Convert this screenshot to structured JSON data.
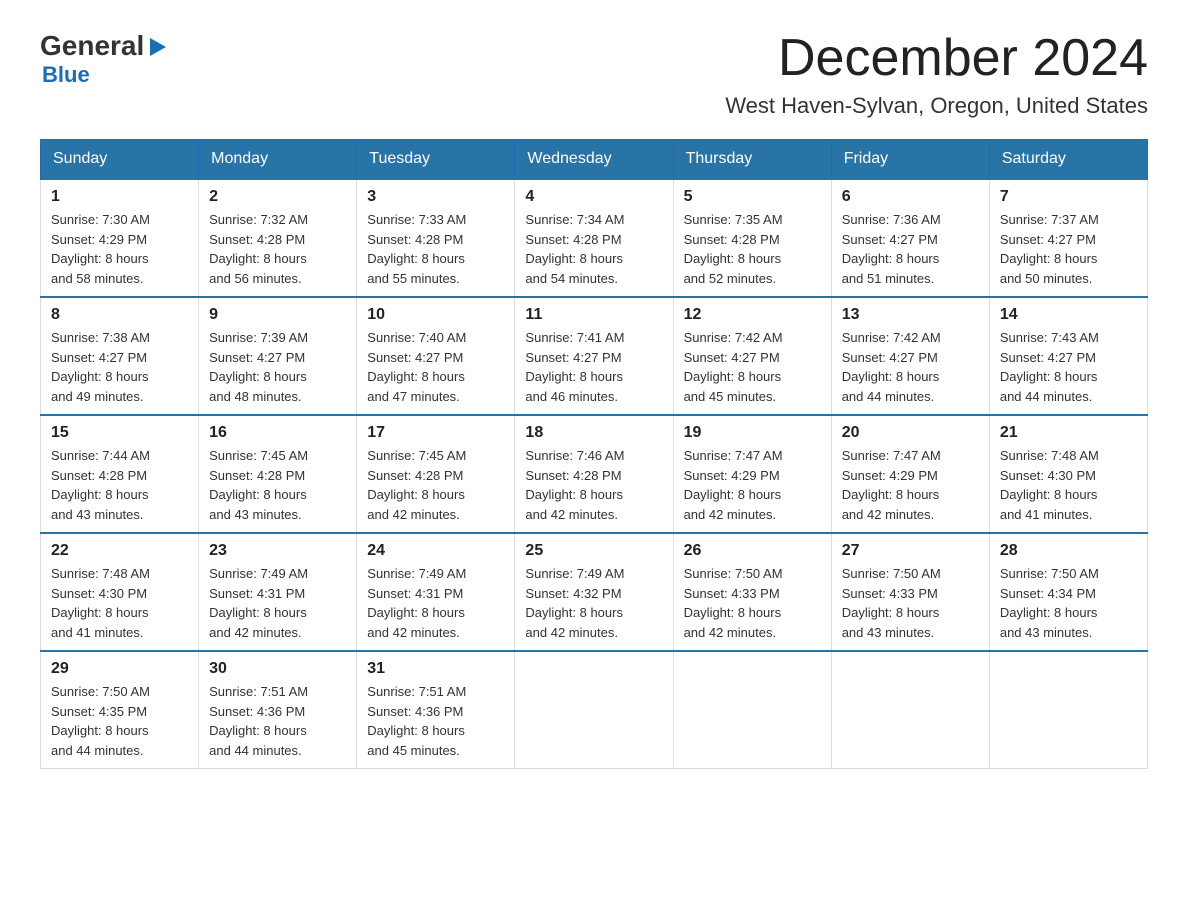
{
  "header": {
    "logo_general": "General",
    "logo_blue": "Blue",
    "logo_sub": "Blue",
    "calendar_title": "December 2024",
    "location": "West Haven-Sylvan, Oregon, United States"
  },
  "days_of_week": [
    "Sunday",
    "Monday",
    "Tuesday",
    "Wednesday",
    "Thursday",
    "Friday",
    "Saturday"
  ],
  "weeks": [
    [
      {
        "day": "1",
        "sunrise": "7:30 AM",
        "sunset": "4:29 PM",
        "daylight_hours": "8",
        "daylight_minutes": "58"
      },
      {
        "day": "2",
        "sunrise": "7:32 AM",
        "sunset": "4:28 PM",
        "daylight_hours": "8",
        "daylight_minutes": "56"
      },
      {
        "day": "3",
        "sunrise": "7:33 AM",
        "sunset": "4:28 PM",
        "daylight_hours": "8",
        "daylight_minutes": "55"
      },
      {
        "day": "4",
        "sunrise": "7:34 AM",
        "sunset": "4:28 PM",
        "daylight_hours": "8",
        "daylight_minutes": "54"
      },
      {
        "day": "5",
        "sunrise": "7:35 AM",
        "sunset": "4:28 PM",
        "daylight_hours": "8",
        "daylight_minutes": "52"
      },
      {
        "day": "6",
        "sunrise": "7:36 AM",
        "sunset": "4:27 PM",
        "daylight_hours": "8",
        "daylight_minutes": "51"
      },
      {
        "day": "7",
        "sunrise": "7:37 AM",
        "sunset": "4:27 PM",
        "daylight_hours": "8",
        "daylight_minutes": "50"
      }
    ],
    [
      {
        "day": "8",
        "sunrise": "7:38 AM",
        "sunset": "4:27 PM",
        "daylight_hours": "8",
        "daylight_minutes": "49"
      },
      {
        "day": "9",
        "sunrise": "7:39 AM",
        "sunset": "4:27 PM",
        "daylight_hours": "8",
        "daylight_minutes": "48"
      },
      {
        "day": "10",
        "sunrise": "7:40 AM",
        "sunset": "4:27 PM",
        "daylight_hours": "8",
        "daylight_minutes": "47"
      },
      {
        "day": "11",
        "sunrise": "7:41 AM",
        "sunset": "4:27 PM",
        "daylight_hours": "8",
        "daylight_minutes": "46"
      },
      {
        "day": "12",
        "sunrise": "7:42 AM",
        "sunset": "4:27 PM",
        "daylight_hours": "8",
        "daylight_minutes": "45"
      },
      {
        "day": "13",
        "sunrise": "7:42 AM",
        "sunset": "4:27 PM",
        "daylight_hours": "8",
        "daylight_minutes": "44"
      },
      {
        "day": "14",
        "sunrise": "7:43 AM",
        "sunset": "4:27 PM",
        "daylight_hours": "8",
        "daylight_minutes": "44"
      }
    ],
    [
      {
        "day": "15",
        "sunrise": "7:44 AM",
        "sunset": "4:28 PM",
        "daylight_hours": "8",
        "daylight_minutes": "43"
      },
      {
        "day": "16",
        "sunrise": "7:45 AM",
        "sunset": "4:28 PM",
        "daylight_hours": "8",
        "daylight_minutes": "43"
      },
      {
        "day": "17",
        "sunrise": "7:45 AM",
        "sunset": "4:28 PM",
        "daylight_hours": "8",
        "daylight_minutes": "42"
      },
      {
        "day": "18",
        "sunrise": "7:46 AM",
        "sunset": "4:28 PM",
        "daylight_hours": "8",
        "daylight_minutes": "42"
      },
      {
        "day": "19",
        "sunrise": "7:47 AM",
        "sunset": "4:29 PM",
        "daylight_hours": "8",
        "daylight_minutes": "42"
      },
      {
        "day": "20",
        "sunrise": "7:47 AM",
        "sunset": "4:29 PM",
        "daylight_hours": "8",
        "daylight_minutes": "42"
      },
      {
        "day": "21",
        "sunrise": "7:48 AM",
        "sunset": "4:30 PM",
        "daylight_hours": "8",
        "daylight_minutes": "41"
      }
    ],
    [
      {
        "day": "22",
        "sunrise": "7:48 AM",
        "sunset": "4:30 PM",
        "daylight_hours": "8",
        "daylight_minutes": "41"
      },
      {
        "day": "23",
        "sunrise": "7:49 AM",
        "sunset": "4:31 PM",
        "daylight_hours": "8",
        "daylight_minutes": "42"
      },
      {
        "day": "24",
        "sunrise": "7:49 AM",
        "sunset": "4:31 PM",
        "daylight_hours": "8",
        "daylight_minutes": "42"
      },
      {
        "day": "25",
        "sunrise": "7:49 AM",
        "sunset": "4:32 PM",
        "daylight_hours": "8",
        "daylight_minutes": "42"
      },
      {
        "day": "26",
        "sunrise": "7:50 AM",
        "sunset": "4:33 PM",
        "daylight_hours": "8",
        "daylight_minutes": "42"
      },
      {
        "day": "27",
        "sunrise": "7:50 AM",
        "sunset": "4:33 PM",
        "daylight_hours": "8",
        "daylight_minutes": "43"
      },
      {
        "day": "28",
        "sunrise": "7:50 AM",
        "sunset": "4:34 PM",
        "daylight_hours": "8",
        "daylight_minutes": "43"
      }
    ],
    [
      {
        "day": "29",
        "sunrise": "7:50 AM",
        "sunset": "4:35 PM",
        "daylight_hours": "8",
        "daylight_minutes": "44"
      },
      {
        "day": "30",
        "sunrise": "7:51 AM",
        "sunset": "4:36 PM",
        "daylight_hours": "8",
        "daylight_minutes": "44"
      },
      {
        "day": "31",
        "sunrise": "7:51 AM",
        "sunset": "4:36 PM",
        "daylight_hours": "8",
        "daylight_minutes": "45"
      },
      null,
      null,
      null,
      null
    ]
  ]
}
